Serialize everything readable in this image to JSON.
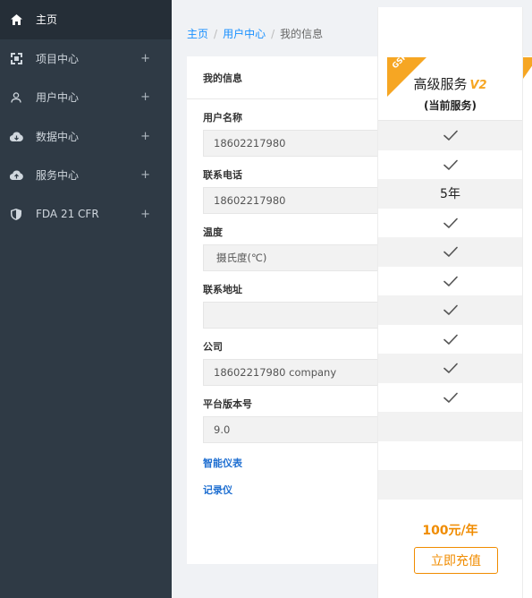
{
  "sidebar": {
    "items": [
      {
        "label": "主页",
        "icon": "home-icon",
        "active": true
      },
      {
        "label": "项目中心",
        "icon": "project-icon",
        "expand": "+"
      },
      {
        "label": "用户中心",
        "icon": "user-icon",
        "expand": "+"
      },
      {
        "label": "数据中心",
        "icon": "cloud-icon",
        "expand": "+"
      },
      {
        "label": "服务中心",
        "icon": "cloud-service-icon",
        "expand": "+"
      },
      {
        "label": "FDA 21 CFR",
        "icon": "shield-icon",
        "expand": "+"
      }
    ]
  },
  "breadcrumb": {
    "home": "主页",
    "user_center": "用户中心",
    "current": "我的信息",
    "separator": "/"
  },
  "card": {
    "title": "我的信息",
    "fields": [
      {
        "label": "用户名称",
        "value": "18602217980"
      },
      {
        "label": "联系电话",
        "value": "18602217980"
      },
      {
        "label": "温度",
        "value": "摄氏度(℃)"
      },
      {
        "label": "联系地址",
        "value": ""
      },
      {
        "label": "公司",
        "value": "18602217980 company"
      },
      {
        "label": "平台版本号",
        "value": "9.0"
      }
    ],
    "links": [
      "智能仪表",
      "记录仪"
    ]
  },
  "plan": {
    "ribbon": "GSP",
    "title": "高级服务",
    "version_badge": "V2",
    "subtitle": "(当前服务)",
    "features": [
      "check",
      "check",
      "5年",
      "check",
      "check",
      "check",
      "check",
      "check",
      "check",
      "check",
      "",
      "",
      "",
      ""
    ],
    "price": "100元/年",
    "button": "立即充值"
  },
  "colors": {
    "sidebar": "#2f3a45",
    "accent": "#f08c00",
    "ribbon": "#f6a623",
    "link": "#1890ff"
  }
}
